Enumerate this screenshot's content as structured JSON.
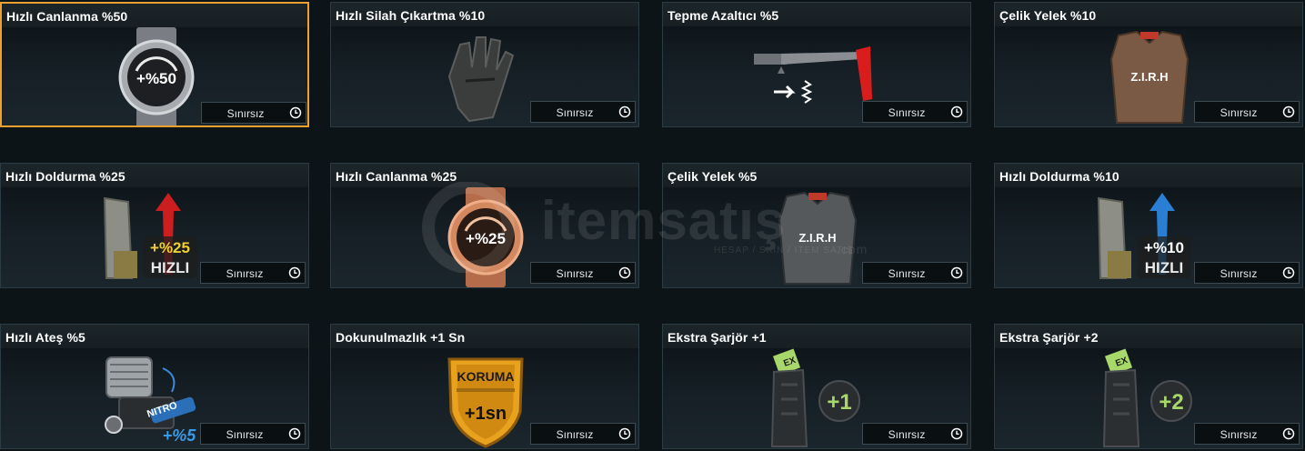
{
  "badge": {
    "duration_label": "Sınırsız",
    "icon": "clock-icon"
  },
  "colors": {
    "selected_border": "#f0a030",
    "card_border": "#2c3c44",
    "background": "#0d1418"
  },
  "items": [
    {
      "title": "Hızlı Canlanma %50",
      "icon": "silver-watch-icon",
      "art_text": "+%50",
      "selected": true
    },
    {
      "title": "Hızlı Silah Çıkartma %10",
      "icon": "tactical-glove-icon",
      "selected": false
    },
    {
      "title": "Tepme Azaltıcı %5",
      "icon": "rifle-stock-recoil-icon",
      "selected": false
    },
    {
      "title": "Çelik Yelek %10",
      "icon": "armor-vest-icon",
      "art_text": "Z.I.R.H",
      "selected": false
    },
    {
      "title": "Hızlı Doldurma %25",
      "icon": "magazine-speed-icon",
      "art_text": "+%25",
      "art_subtext": "HIZLI",
      "selected": false
    },
    {
      "title": "Hızlı Canlanma %25",
      "icon": "bronze-watch-icon",
      "art_text": "+%25",
      "selected": false
    },
    {
      "title": "Çelik Yelek %5",
      "icon": "armor-vest-icon",
      "art_text": "Z.I.R.H",
      "selected": false
    },
    {
      "title": "Hızlı Doldurma %10",
      "icon": "magazine-speed-icon",
      "art_text": "+%10",
      "art_subtext": "HIZLI",
      "selected": false
    },
    {
      "title": "Hızlı Ateş %5",
      "icon": "nitro-engine-icon",
      "art_text": "+%5",
      "art_subtext": "NITRO",
      "selected": false
    },
    {
      "title": "Dokunulmazlık +1 Sn",
      "icon": "koruma-shield-icon",
      "art_text": "KORUMA",
      "art_subtext": "+1sn",
      "selected": false
    },
    {
      "title": "Ekstra Şarjör +1",
      "icon": "extra-magazine-icon",
      "art_text": "+1",
      "art_subtext": "EX",
      "selected": false
    },
    {
      "title": "Ekstra Şarjör +2",
      "icon": "extra-magazine-icon",
      "art_text": "+2",
      "art_subtext": "EX",
      "selected": false
    }
  ],
  "watermark": {
    "text": "itemsatış",
    "subtext": "HESAP / SKIN / ITEM SATIŞ",
    "domain": ".com"
  }
}
